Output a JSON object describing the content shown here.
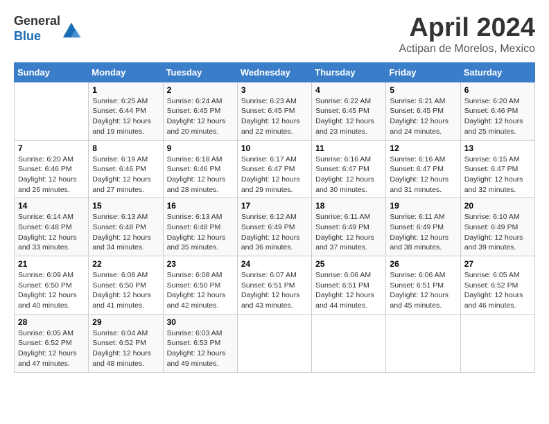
{
  "header": {
    "logo_line1": "General",
    "logo_line2": "Blue",
    "month_title": "April 2024",
    "subtitle": "Actipan de Morelos, Mexico"
  },
  "calendar": {
    "days_of_week": [
      "Sunday",
      "Monday",
      "Tuesday",
      "Wednesday",
      "Thursday",
      "Friday",
      "Saturday"
    ],
    "weeks": [
      [
        {
          "day": "",
          "info": ""
        },
        {
          "day": "1",
          "info": "Sunrise: 6:25 AM\nSunset: 6:44 PM\nDaylight: 12 hours\nand 19 minutes."
        },
        {
          "day": "2",
          "info": "Sunrise: 6:24 AM\nSunset: 6:45 PM\nDaylight: 12 hours\nand 20 minutes."
        },
        {
          "day": "3",
          "info": "Sunrise: 6:23 AM\nSunset: 6:45 PM\nDaylight: 12 hours\nand 22 minutes."
        },
        {
          "day": "4",
          "info": "Sunrise: 6:22 AM\nSunset: 6:45 PM\nDaylight: 12 hours\nand 23 minutes."
        },
        {
          "day": "5",
          "info": "Sunrise: 6:21 AM\nSunset: 6:45 PM\nDaylight: 12 hours\nand 24 minutes."
        },
        {
          "day": "6",
          "info": "Sunrise: 6:20 AM\nSunset: 6:46 PM\nDaylight: 12 hours\nand 25 minutes."
        }
      ],
      [
        {
          "day": "7",
          "info": "Sunrise: 6:20 AM\nSunset: 6:46 PM\nDaylight: 12 hours\nand 26 minutes."
        },
        {
          "day": "8",
          "info": "Sunrise: 6:19 AM\nSunset: 6:46 PM\nDaylight: 12 hours\nand 27 minutes."
        },
        {
          "day": "9",
          "info": "Sunrise: 6:18 AM\nSunset: 6:46 PM\nDaylight: 12 hours\nand 28 minutes."
        },
        {
          "day": "10",
          "info": "Sunrise: 6:17 AM\nSunset: 6:47 PM\nDaylight: 12 hours\nand 29 minutes."
        },
        {
          "day": "11",
          "info": "Sunrise: 6:16 AM\nSunset: 6:47 PM\nDaylight: 12 hours\nand 30 minutes."
        },
        {
          "day": "12",
          "info": "Sunrise: 6:16 AM\nSunset: 6:47 PM\nDaylight: 12 hours\nand 31 minutes."
        },
        {
          "day": "13",
          "info": "Sunrise: 6:15 AM\nSunset: 6:47 PM\nDaylight: 12 hours\nand 32 minutes."
        }
      ],
      [
        {
          "day": "14",
          "info": "Sunrise: 6:14 AM\nSunset: 6:48 PM\nDaylight: 12 hours\nand 33 minutes."
        },
        {
          "day": "15",
          "info": "Sunrise: 6:13 AM\nSunset: 6:48 PM\nDaylight: 12 hours\nand 34 minutes."
        },
        {
          "day": "16",
          "info": "Sunrise: 6:13 AM\nSunset: 6:48 PM\nDaylight: 12 hours\nand 35 minutes."
        },
        {
          "day": "17",
          "info": "Sunrise: 6:12 AM\nSunset: 6:49 PM\nDaylight: 12 hours\nand 36 minutes."
        },
        {
          "day": "18",
          "info": "Sunrise: 6:11 AM\nSunset: 6:49 PM\nDaylight: 12 hours\nand 37 minutes."
        },
        {
          "day": "19",
          "info": "Sunrise: 6:11 AM\nSunset: 6:49 PM\nDaylight: 12 hours\nand 38 minutes."
        },
        {
          "day": "20",
          "info": "Sunrise: 6:10 AM\nSunset: 6:49 PM\nDaylight: 12 hours\nand 39 minutes."
        }
      ],
      [
        {
          "day": "21",
          "info": "Sunrise: 6:09 AM\nSunset: 6:50 PM\nDaylight: 12 hours\nand 40 minutes."
        },
        {
          "day": "22",
          "info": "Sunrise: 6:08 AM\nSunset: 6:50 PM\nDaylight: 12 hours\nand 41 minutes."
        },
        {
          "day": "23",
          "info": "Sunrise: 6:08 AM\nSunset: 6:50 PM\nDaylight: 12 hours\nand 42 minutes."
        },
        {
          "day": "24",
          "info": "Sunrise: 6:07 AM\nSunset: 6:51 PM\nDaylight: 12 hours\nand 43 minutes."
        },
        {
          "day": "25",
          "info": "Sunrise: 6:06 AM\nSunset: 6:51 PM\nDaylight: 12 hours\nand 44 minutes."
        },
        {
          "day": "26",
          "info": "Sunrise: 6:06 AM\nSunset: 6:51 PM\nDaylight: 12 hours\nand 45 minutes."
        },
        {
          "day": "27",
          "info": "Sunrise: 6:05 AM\nSunset: 6:52 PM\nDaylight: 12 hours\nand 46 minutes."
        }
      ],
      [
        {
          "day": "28",
          "info": "Sunrise: 6:05 AM\nSunset: 6:52 PM\nDaylight: 12 hours\nand 47 minutes."
        },
        {
          "day": "29",
          "info": "Sunrise: 6:04 AM\nSunset: 6:52 PM\nDaylight: 12 hours\nand 48 minutes."
        },
        {
          "day": "30",
          "info": "Sunrise: 6:03 AM\nSunset: 6:53 PM\nDaylight: 12 hours\nand 49 minutes."
        },
        {
          "day": "",
          "info": ""
        },
        {
          "day": "",
          "info": ""
        },
        {
          "day": "",
          "info": ""
        },
        {
          "day": "",
          "info": ""
        }
      ]
    ]
  }
}
